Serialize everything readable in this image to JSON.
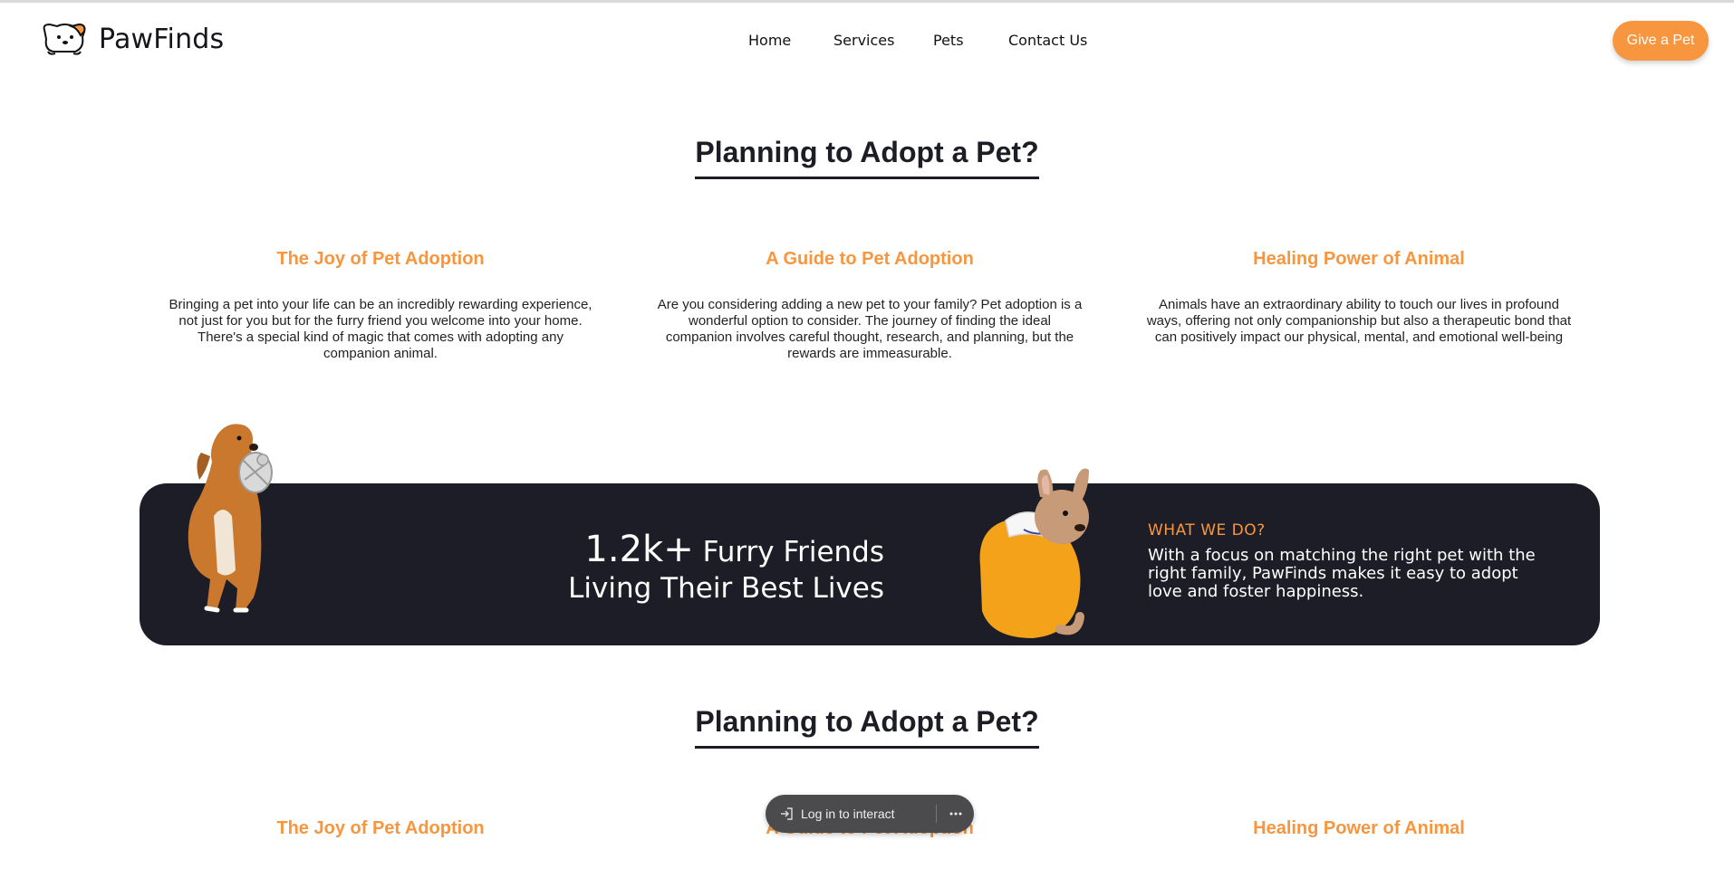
{
  "brand": {
    "name": "PawFinds"
  },
  "nav": {
    "items": [
      {
        "label": "Home"
      },
      {
        "label": "Services"
      },
      {
        "label": "Pets"
      },
      {
        "label": "Contact Us"
      }
    ],
    "cta_label": "Give a Pet"
  },
  "section1": {
    "title": "Planning to Adopt a Pet?",
    "features": [
      {
        "title": "The Joy of Pet Adoption",
        "text": "Bringing a pet into your life can be an incredibly rewarding experience, not just for you but for the furry friend you welcome into your home. There's a special kind of magic that comes with adopting any companion animal."
      },
      {
        "title": "A Guide to Pet Adoption",
        "text": "Are you considering adding a new pet to your family? Pet adoption is a wonderful option to consider. The journey of finding the ideal companion involves careful thought, research, and planning, but the rewards are immeasurable."
      },
      {
        "title": "Healing Power of Animal",
        "text": "Animals have an extraordinary ability to touch our lives in profound ways, offering not only companionship but also a therapeutic bond that can positively impact our physical, mental, and emotional well-being"
      }
    ]
  },
  "banner": {
    "stat_number": "1.2k+",
    "stat_line1": "Furry Friends",
    "stat_line2": "Living Their Best Lives",
    "eyebrow": "WHAT WE DO?",
    "description": "With a focus on matching the right pet with the right family, PawFinds makes it easy to adopt love and foster happiness."
  },
  "section2": {
    "title": "Planning to Adopt a Pet?",
    "features": [
      {
        "title": "The Joy of Pet Adoption"
      },
      {
        "title": "A Guide to Pet Adoption"
      },
      {
        "title": "Healing Power of Animal"
      }
    ]
  },
  "overlay": {
    "login_label": "Log in to interact",
    "more_icon": "ellipsis-icon",
    "login_icon": "login-arrow-icon"
  },
  "colors": {
    "accent": "#f7963e",
    "dark": "#1c1d27"
  }
}
